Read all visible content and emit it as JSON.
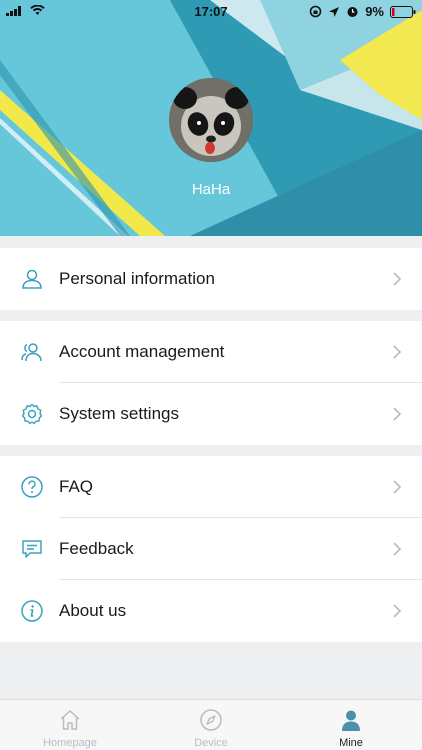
{
  "status_bar": {
    "time": "17:07",
    "battery": "9%"
  },
  "profile": {
    "username": "HaHa"
  },
  "menu": {
    "personal_information": "Personal information",
    "account_management": "Account management",
    "system_settings": "System settings",
    "faq": "FAQ",
    "feedback": "Feedback",
    "about_us": "About us"
  },
  "tabbar": {
    "tabs": [
      {
        "label": "Homepage",
        "icon": "home-icon",
        "active": false
      },
      {
        "label": "Device",
        "icon": "compass-icon",
        "active": false
      },
      {
        "label": "Mine",
        "icon": "person-icon",
        "active": true
      }
    ]
  },
  "colors": {
    "icon_accent": "#3aa0c0",
    "hero_blue": "#3aa7bf",
    "hero_yellow": "#f2e84a",
    "active_tab": "#4a90a8"
  }
}
